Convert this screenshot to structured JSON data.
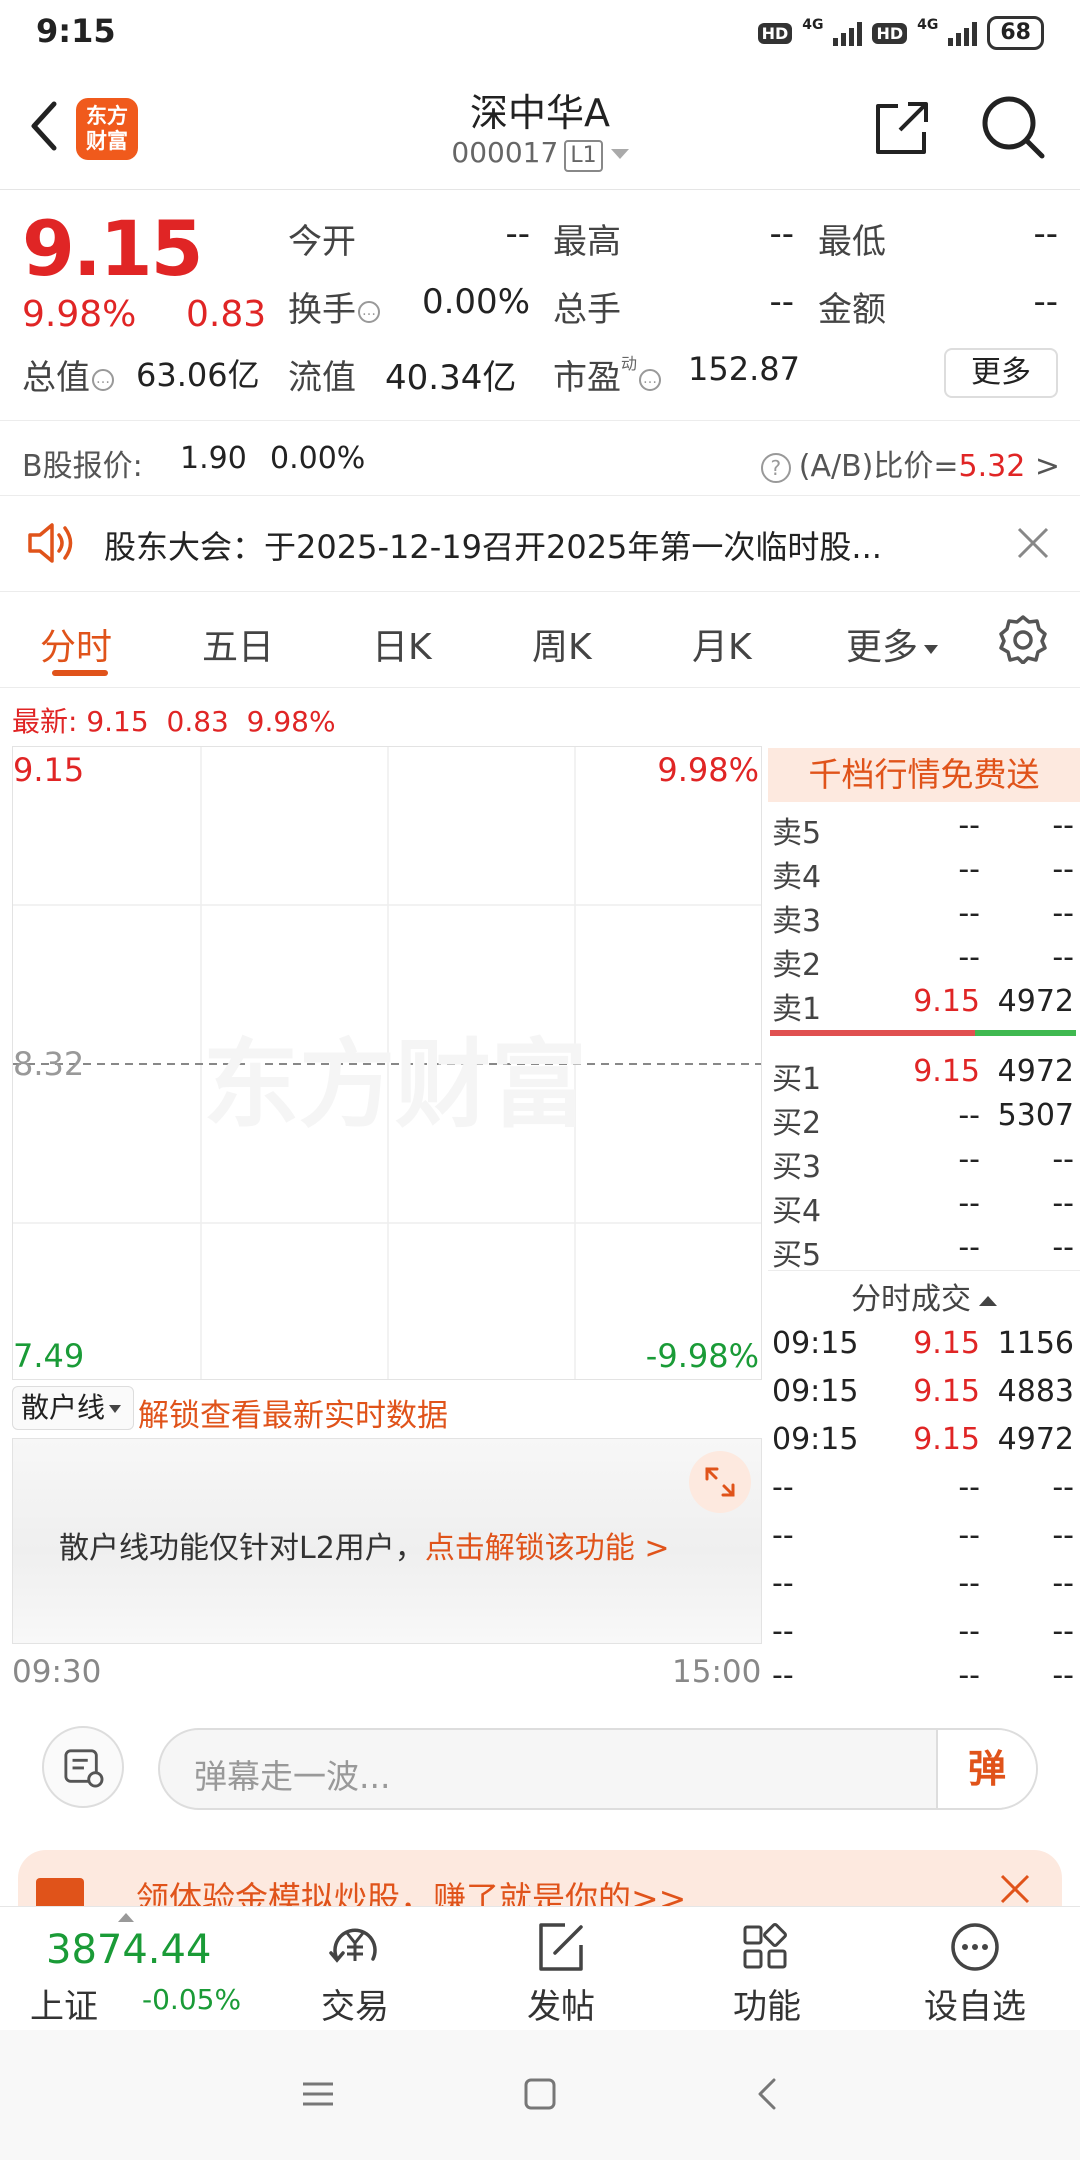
{
  "status_bar": {
    "time": "9:15",
    "hd": "HD",
    "net": "4G",
    "battery": "68"
  },
  "header": {
    "logo": [
      "东方",
      "财富"
    ],
    "stock_name": "深中华A",
    "stock_code": "000017",
    "level_badge": "L1"
  },
  "quote": {
    "price": "9.15",
    "change_pct": "9.98%",
    "change_abs": "0.83",
    "open_label": "今开",
    "open_value": "--",
    "high_label": "最高",
    "high_value": "--",
    "low_label": "最低",
    "low_value": "--",
    "turnover_label": "换手",
    "turnover_value": "0.00%",
    "volume_label": "总手",
    "volume_value": "--",
    "amount_label": "金额",
    "amount_value": "--",
    "mktcap_label": "总值",
    "mktcap_value": "63.06亿",
    "float_label": "流值",
    "float_value": "40.34亿",
    "pe_label": "市盈",
    "pe_sup": "动",
    "pe_value": "152.87",
    "more_label": "更多"
  },
  "b_share": {
    "label": "B股报价:",
    "price": "1.90",
    "pct": "0.00%",
    "ratio_label": "(A/B)比价=",
    "ratio_value": "5.32",
    "ratio_arrow": ">"
  },
  "notice": {
    "text": "股东大会：于2025-12-19召开2025年第一次临时股..."
  },
  "tabs": [
    {
      "label": "分时",
      "active": true
    },
    {
      "label": "五日"
    },
    {
      "label": "日K"
    },
    {
      "label": "周K"
    },
    {
      "label": "月K"
    },
    {
      "label": "更多"
    }
  ],
  "latest": {
    "label": "最新:",
    "price": "9.15",
    "chg": "0.83",
    "pct": "9.98%"
  },
  "chart": {
    "top_price": "9.15",
    "top_pct": "9.98%",
    "mid_price": "8.32",
    "bottom_price": "7.49",
    "bottom_pct": "-9.98%",
    "watermark": "东方财富",
    "time_start": "09:30",
    "time_end": "15:00",
    "colors": {
      "up": "#e02525",
      "down": "#1a9b37",
      "grid": "#e6e6e6"
    }
  },
  "orderbook": {
    "banner": "千档行情免费送",
    "asks": [
      {
        "label": "卖5",
        "price": "--",
        "vol": "--"
      },
      {
        "label": "卖4",
        "price": "--",
        "vol": "--"
      },
      {
        "label": "卖3",
        "price": "--",
        "vol": "--"
      },
      {
        "label": "卖2",
        "price": "--",
        "vol": "--"
      },
      {
        "label": "卖1",
        "price": "9.15",
        "vol": "4972"
      }
    ],
    "bids": [
      {
        "label": "买1",
        "price": "9.15",
        "vol": "4972"
      },
      {
        "label": "买2",
        "price": "--",
        "vol": "5307"
      },
      {
        "label": "买3",
        "price": "--",
        "vol": "--"
      },
      {
        "label": "买4",
        "price": "--",
        "vol": "--"
      },
      {
        "label": "买5",
        "price": "--",
        "vol": "--"
      }
    ],
    "trades_title": "分时成交",
    "trades": [
      {
        "time": "09:15",
        "price": "9.15",
        "vol": "1156"
      },
      {
        "time": "09:15",
        "price": "9.15",
        "vol": "4883"
      },
      {
        "time": "09:15",
        "price": "9.15",
        "vol": "4972"
      },
      {
        "time": "--",
        "price": "--",
        "vol": "--"
      },
      {
        "time": "--",
        "price": "--",
        "vol": "--"
      },
      {
        "time": "--",
        "price": "--",
        "vol": "--"
      },
      {
        "time": "--",
        "price": "--",
        "vol": "--"
      },
      {
        "time": "--",
        "price": "--",
        "vol": "--"
      }
    ]
  },
  "retail": {
    "select_label": "散户线",
    "unlock_link": "解锁查看最新实时数据",
    "message": "散户线功能仅针对L2用户，",
    "message_link": "点击解锁该功能 >"
  },
  "comment": {
    "placeholder": "弹幕走一波...",
    "danmu_label": "弹"
  },
  "promo": {
    "text": "领体验金模拟炒股，赚了就是你的>>"
  },
  "bottom_nav": {
    "index_value": "3874.44",
    "index_name": "上证",
    "index_change": "-0.05%",
    "items": [
      {
        "label": "交易"
      },
      {
        "label": "发帖"
      },
      {
        "label": "功能"
      },
      {
        "label": "设自选"
      }
    ]
  }
}
